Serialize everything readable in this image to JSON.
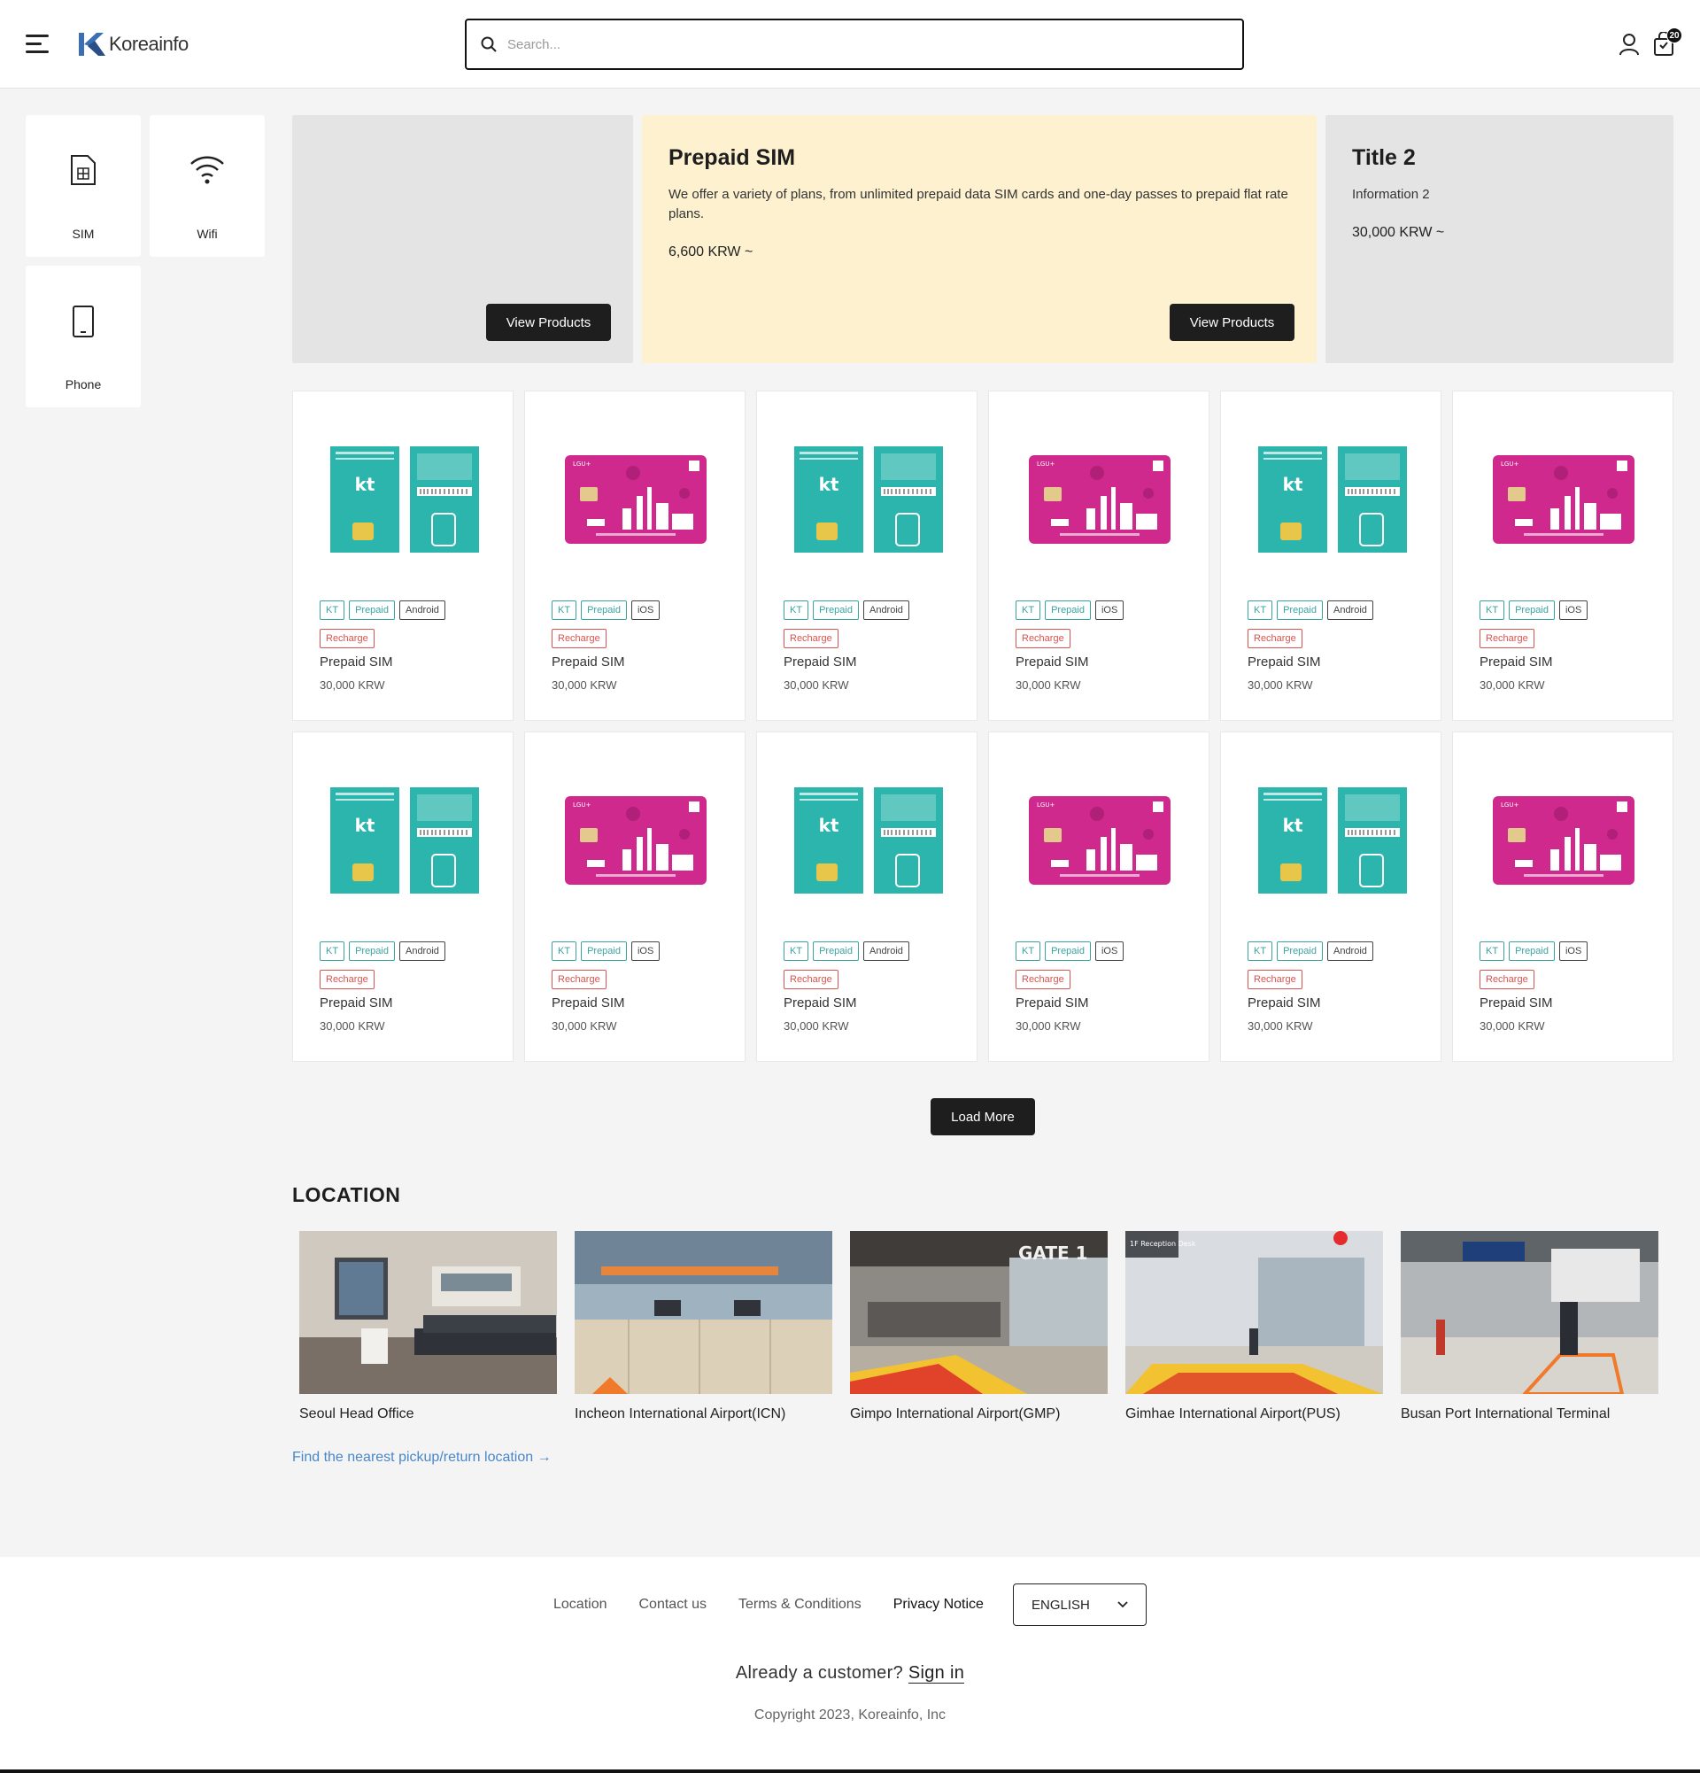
{
  "header": {
    "logo_text": "Koreainfo",
    "search_placeholder": "Search...",
    "cart_count": "20"
  },
  "categories": [
    {
      "label": "SIM",
      "icon": "sim-card-icon"
    },
    {
      "label": "Wifi",
      "icon": "wifi-icon"
    },
    {
      "label": "Phone",
      "icon": "phone-icon"
    }
  ],
  "banners": [
    {
      "title": "",
      "button": "View Products"
    },
    {
      "title": "Prepaid SIM",
      "description": "We offer a variety of plans, from unlimited prepaid data SIM cards and one-day passes to prepaid flat rate plans.",
      "price": "6,600 KRW ~",
      "button": "View Products",
      "bg": "#fdf1cf"
    },
    {
      "title": "Title 2",
      "description": "Information 2",
      "price": "30,000 KRW ~"
    }
  ],
  "products": [
    {
      "carrier": "kt",
      "tags": [
        "KT",
        "Prepaid",
        "Android",
        "Recharge"
      ],
      "title": "Prepaid SIM",
      "price": "30,000 KRW"
    },
    {
      "carrier": "lgu",
      "tags": [
        "KT",
        "Prepaid",
        "iOS",
        "Recharge"
      ],
      "title": "Prepaid SIM",
      "price": "30,000 KRW"
    },
    {
      "carrier": "kt",
      "tags": [
        "KT",
        "Prepaid",
        "Android",
        "Recharge"
      ],
      "title": "Prepaid SIM",
      "price": "30,000 KRW"
    },
    {
      "carrier": "lgu",
      "tags": [
        "KT",
        "Prepaid",
        "iOS",
        "Recharge"
      ],
      "title": "Prepaid SIM",
      "price": "30,000 KRW"
    },
    {
      "carrier": "kt",
      "tags": [
        "KT",
        "Prepaid",
        "Android",
        "Recharge"
      ],
      "title": "Prepaid SIM",
      "price": "30,000 KRW"
    },
    {
      "carrier": "lgu",
      "tags": [
        "KT",
        "Prepaid",
        "iOS",
        "Recharge"
      ],
      "title": "Prepaid SIM",
      "price": "30,000 KRW"
    },
    {
      "carrier": "kt",
      "tags": [
        "KT",
        "Prepaid",
        "Android",
        "Recharge"
      ],
      "title": "Prepaid SIM",
      "price": "30,000 KRW"
    },
    {
      "carrier": "lgu",
      "tags": [
        "KT",
        "Prepaid",
        "iOS",
        "Recharge"
      ],
      "title": "Prepaid SIM",
      "price": "30,000 KRW"
    },
    {
      "carrier": "kt",
      "tags": [
        "KT",
        "Prepaid",
        "Android",
        "Recharge"
      ],
      "title": "Prepaid SIM",
      "price": "30,000 KRW"
    },
    {
      "carrier": "lgu",
      "tags": [
        "KT",
        "Prepaid",
        "iOS",
        "Recharge"
      ],
      "title": "Prepaid SIM",
      "price": "30,000 KRW"
    },
    {
      "carrier": "kt",
      "tags": [
        "KT",
        "Prepaid",
        "Android",
        "Recharge"
      ],
      "title": "Prepaid SIM",
      "price": "30,000 KRW"
    },
    {
      "carrier": "lgu",
      "tags": [
        "KT",
        "Prepaid",
        "iOS",
        "Recharge"
      ],
      "title": "Prepaid SIM",
      "price": "30,000 KRW"
    }
  ],
  "load_more": "Load More",
  "location": {
    "heading": "LOCATION",
    "items": [
      {
        "name": "Seoul Head Office"
      },
      {
        "name": "Incheon International Airport(ICN)"
      },
      {
        "name": "Gimpo International Airport(GMP)",
        "sign": "GATE 1"
      },
      {
        "name": "Gimhae International Airport(PUS)",
        "sign": "1F Reception Desk"
      },
      {
        "name": "Busan Port International Terminal"
      }
    ],
    "link": "Find the nearest pickup/return location →"
  },
  "footer": {
    "links": [
      "Location",
      "Contact us",
      "Terms & Conditions",
      "Privacy Notice"
    ],
    "language": "ENGLISH",
    "already": "Already a customer?",
    "signin": "Sign in",
    "copyright": "Copyright 2023, Koreainfo, Inc"
  },
  "colors": {
    "kt_teal": "#2cb5ad",
    "lgu_magenta": "#d0298e",
    "banner_yellow": "#fdf1cf",
    "link_blue": "#4a87c9"
  }
}
